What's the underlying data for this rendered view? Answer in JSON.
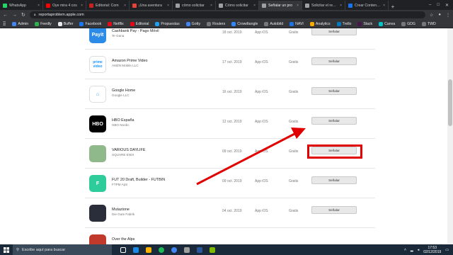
{
  "browser": {
    "tabs": [
      {
        "label": "WhatsApp",
        "color": "#25d366",
        "active": false
      },
      {
        "label": "Oye mira 4 cos",
        "color": "#ff0000",
        "active": false
      },
      {
        "label": "Editorial: Com",
        "color": "#c5221f",
        "active": false
      },
      {
        "label": "¡Una aventura",
        "color": "#ea4335",
        "active": false
      },
      {
        "label": "cómo solicitar",
        "color": "#9aa0a6",
        "active": false
      },
      {
        "label": "Cómo solicitar",
        "color": "#9aa0a6",
        "active": false
      },
      {
        "label": "Señalar un pro",
        "color": "#9aa0a6",
        "active": true
      },
      {
        "label": "Solicitar el reemb",
        "color": "#9aa0a6",
        "active": false
      },
      {
        "label": "Crear Contenido",
        "color": "#1a73e8",
        "active": false
      }
    ],
    "new_tab": "+",
    "close_glyph": "×",
    "url": "reportaproblem.apple.com",
    "window_controls": [
      "–",
      "□",
      "✕"
    ]
  },
  "bookmarks": [
    {
      "label": "Admin",
      "color": "#4285f4"
    },
    {
      "label": "Feedly",
      "color": "#2bb24c"
    },
    {
      "label": "Buffer",
      "color": "#e8eaed"
    },
    {
      "label": "Facebook",
      "color": "#1877f2"
    },
    {
      "label": "Netflix",
      "color": "#e50914"
    },
    {
      "label": "Editorial",
      "color": "#e50914"
    },
    {
      "label": "Propuestas",
      "color": "#1da1f2"
    },
    {
      "label": "Gotty",
      "color": "#4285f4"
    },
    {
      "label": "Routers",
      "color": "#777777"
    },
    {
      "label": "Crowdtangle",
      "color": "#2d88ff"
    },
    {
      "label": "Autobild",
      "color": "#777777"
    },
    {
      "label": "NAVI",
      "color": "#1a73e8"
    },
    {
      "label": "Analytics",
      "color": "#f9ab00"
    },
    {
      "label": "Trello",
      "color": "#0079bf"
    },
    {
      "label": "Slack",
      "color": "#4a154b"
    },
    {
      "label": "Canva",
      "color": "#00c4cc"
    },
    {
      "label": "GDG",
      "color": "#777777"
    },
    {
      "label": "TWD",
      "color": "#777777"
    }
  ],
  "apps": [
    {
      "name": "Cashbank Pay - Pago Móvil",
      "developer": "Te Gana",
      "date": "18 oct. 2019",
      "type": "App iOS",
      "price": "Gratis",
      "button": "Señalar",
      "icon_text": "Payit",
      "icon_color": "#2b8be6"
    },
    {
      "name": "Amazon Prime Video",
      "developer": "AMZN Mobile LLC",
      "date": "17 oct. 2019",
      "type": "App iOS",
      "price": "Gratis",
      "button": "Señalar",
      "icon_text": "prime video",
      "icon_color": "#ffffff"
    },
    {
      "name": "Google Home",
      "developer": "Google LLC",
      "date": "16 oct. 2019",
      "type": "App iOS",
      "price": "Gratis",
      "button": "Señalar",
      "icon_text": "⌂",
      "icon_color": "#ffffff"
    },
    {
      "name": "HBO España",
      "developer": "HBO Nordic",
      "date": "12 oct. 2019",
      "type": "App iOS",
      "price": "Gratis",
      "button": "Señalar",
      "icon_text": "HBO",
      "icon_color": "#000000"
    },
    {
      "name": "VARIOUS DAYLIFE",
      "developer": "SQUARE ENIX",
      "date": "09 oct. 2019",
      "type": "App iOS",
      "price": "Gratis",
      "button": "Señalar",
      "icon_text": "",
      "icon_color": "#8fb98a"
    },
    {
      "name": "FUT 20 Draft, Builder - FUTBIN",
      "developer": "FTPM ApS",
      "date": "09 oct. 2019",
      "type": "App iOS",
      "price": "Gratis",
      "button": "Señalar",
      "icon_text": "F",
      "icon_color": "#2ecc9a"
    },
    {
      "name": "Mutazione",
      "developer": "Die Gute Fabrik",
      "date": "04 oct. 2019",
      "type": "App iOS",
      "price": "Gratis",
      "button": "Señalar",
      "icon_text": "",
      "icon_color": "#2a2d3a"
    },
    {
      "name": "Over the Alps",
      "developer": "",
      "date": "",
      "type": "",
      "price": "",
      "button": "",
      "icon_text": "",
      "icon_color": "#c0392b"
    }
  ],
  "annotation": {
    "color": "#e00000"
  },
  "taskbar": {
    "search_placeholder": "Escribe aquí para buscar",
    "time": "17:53",
    "date": "02/12/2019"
  }
}
